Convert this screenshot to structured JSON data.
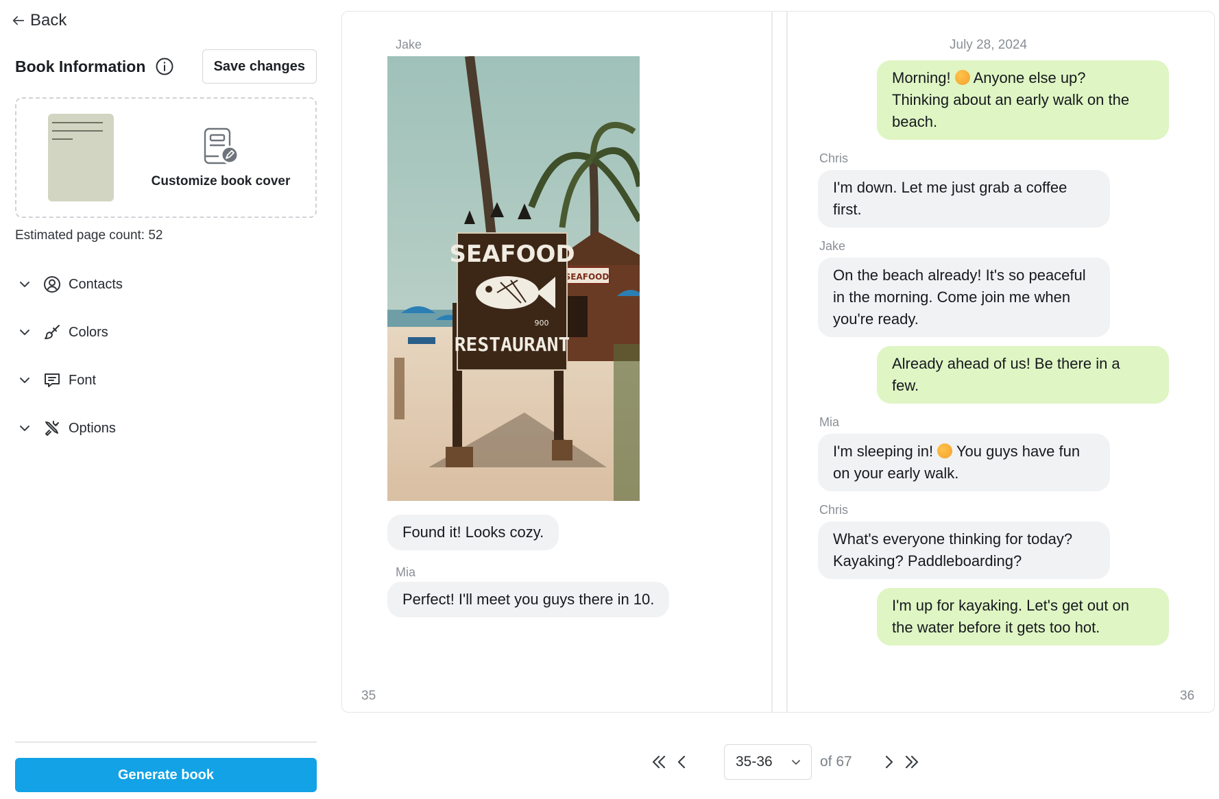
{
  "sidebar": {
    "back_label": "Back",
    "info_title": "Book Information",
    "save_label": "Save changes",
    "customize_label": "Customize book cover",
    "page_count_text": "Estimated page count: 52",
    "sections": [
      {
        "label": "Contacts",
        "icon": "user-circle-icon"
      },
      {
        "label": "Colors",
        "icon": "brush-icon"
      },
      {
        "label": "Font",
        "icon": "message-icon"
      },
      {
        "label": "Options",
        "icon": "tools-icon"
      }
    ],
    "generate_label": "Generate book"
  },
  "colors": {
    "accent": "#12a2e5",
    "bubble_in": "#f1f2f4",
    "bubble_out": "#dff5c4",
    "cover_thumb": "#d3d5c3"
  },
  "left_page": {
    "sender_top": "Jake",
    "photo_sign_top": "SEAFOOD",
    "photo_sign_bottom": "RESTAURANT",
    "photo_sign_small": "SEAFOOD",
    "photo_sign_num": "900",
    "msg1": "Found it! Looks cozy.",
    "sender2": "Mia",
    "msg2": "Perfect! I'll meet you guys there in 10.",
    "page_number": "35"
  },
  "right_page": {
    "date": "July 28, 2024",
    "m1_a": "Morning! ",
    "m1_b": " Anyone else up?",
    "m1_c": "Thinking about an early walk on the",
    "m1_d": "beach.",
    "s2": "Chris",
    "m2_a": "I'm down. Let me just grab a coffee",
    "m2_b": "first.",
    "s3": "Jake",
    "m3_a": "On the beach already! It's so peaceful",
    "m3_b": "in the morning. Come join me when",
    "m3_c": "you're ready.",
    "m4_a": "Already ahead of us! Be there in a",
    "m4_b": "few.",
    "s5": "Mia",
    "m5_a": "I'm sleeping in! ",
    "m5_b": " You guys have fun",
    "m5_c": "on your early walk.",
    "s6": "Chris",
    "m6_a": "What's everyone thinking for today?",
    "m6_b": "Kayaking? Paddleboarding?",
    "m7_a": "I'm up for kayaking. Let's get out on",
    "m7_b": "the water before it gets too hot.",
    "page_number": "36"
  },
  "pager": {
    "current": "35-36",
    "of_text": "of 67"
  }
}
